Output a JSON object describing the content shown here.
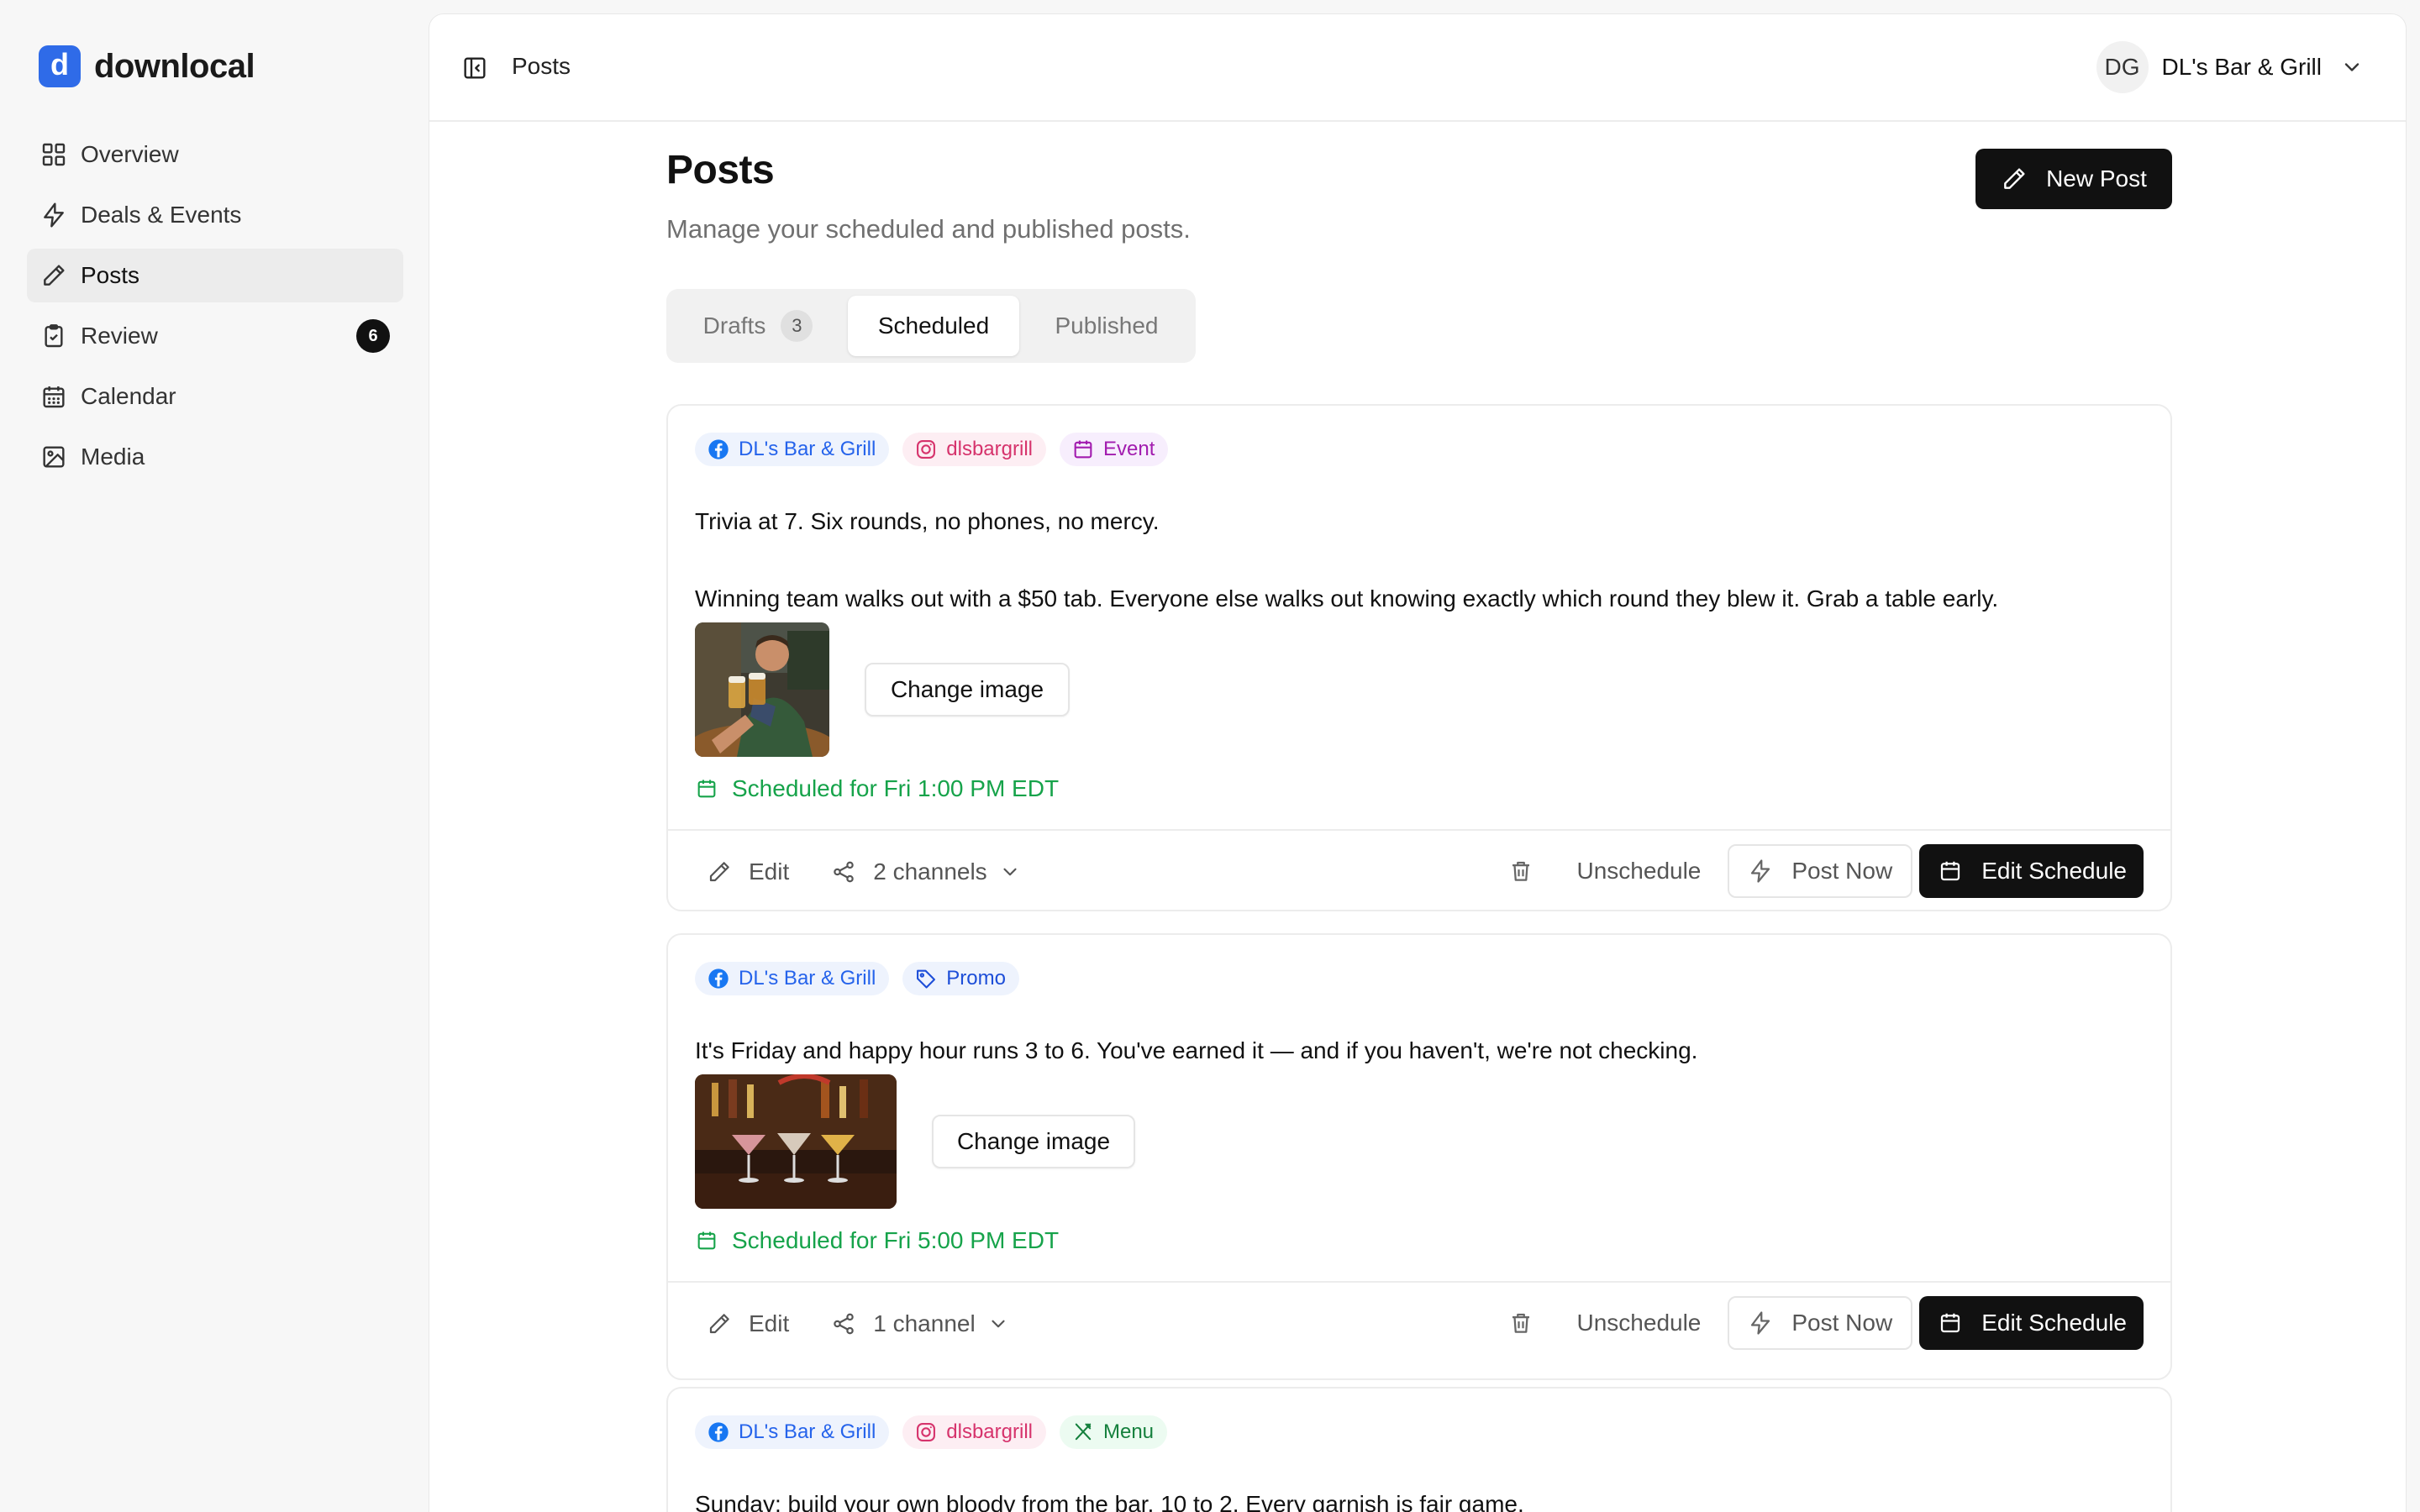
{
  "brand": {
    "logo_letter": "d",
    "name": "downlocal",
    "accent": "#2f6be8"
  },
  "nav": {
    "items": [
      {
        "label": "Overview",
        "icon": "grid-icon"
      },
      {
        "label": "Deals & Events",
        "icon": "bolt-icon"
      },
      {
        "label": "Posts",
        "icon": "pencil-icon",
        "active": true
      },
      {
        "label": "Review",
        "icon": "clipboard-check-icon",
        "badge": "6"
      },
      {
        "label": "Calendar",
        "icon": "calendar-icon"
      },
      {
        "label": "Media",
        "icon": "image-icon"
      }
    ]
  },
  "topbar": {
    "title": "Posts",
    "account": {
      "initials": "DG",
      "name": "DL's Bar & Grill"
    }
  },
  "page": {
    "title": "Posts",
    "subtitle": "Manage your scheduled and published posts.",
    "new_post_label": "New Post"
  },
  "tabs": [
    {
      "label": "Drafts",
      "count": "3"
    },
    {
      "label": "Scheduled",
      "active": true
    },
    {
      "label": "Published"
    }
  ],
  "posts": [
    {
      "chips": [
        {
          "label": "DL's Bar & Grill",
          "type": "facebook"
        },
        {
          "label": "dlsbargrill",
          "type": "instagram"
        },
        {
          "label": "Event",
          "type": "event"
        }
      ],
      "text_lines": [
        "Trivia at 7. Six rounds, no phones, no mercy.",
        "Winning team walks out with a $50 tab. Everyone else walks out knowing exactly which round they blew it. Grab a table early."
      ],
      "change_image_label": "Change image",
      "schedule": "Scheduled for Fri 1:00 PM EDT",
      "footer": {
        "edit": "Edit",
        "channels": "2 channels",
        "unschedule": "Unschedule",
        "post_now": "Post Now",
        "edit_schedule": "Edit Schedule"
      }
    },
    {
      "chips": [
        {
          "label": "DL's Bar & Grill",
          "type": "facebook"
        },
        {
          "label": "Promo",
          "type": "promo"
        }
      ],
      "text_lines": [
        "It's Friday and happy hour runs 3 to 6. You've earned it — and if you haven't, we're not checking."
      ],
      "change_image_label": "Change image",
      "schedule": "Scheduled for Fri 5:00 PM EDT",
      "footer": {
        "edit": "Edit",
        "channels": "1 channel",
        "unschedule": "Unschedule",
        "post_now": "Post Now",
        "edit_schedule": "Edit Schedule"
      }
    },
    {
      "chips": [
        {
          "label": "DL's Bar & Grill",
          "type": "facebook"
        },
        {
          "label": "dlsbargrill",
          "type": "instagram"
        },
        {
          "label": "Menu",
          "type": "menu"
        }
      ],
      "text_lines": [
        "Sunday: build your own bloody from the bar, 10 to 2. Every garnish is fair game."
      ]
    }
  ]
}
